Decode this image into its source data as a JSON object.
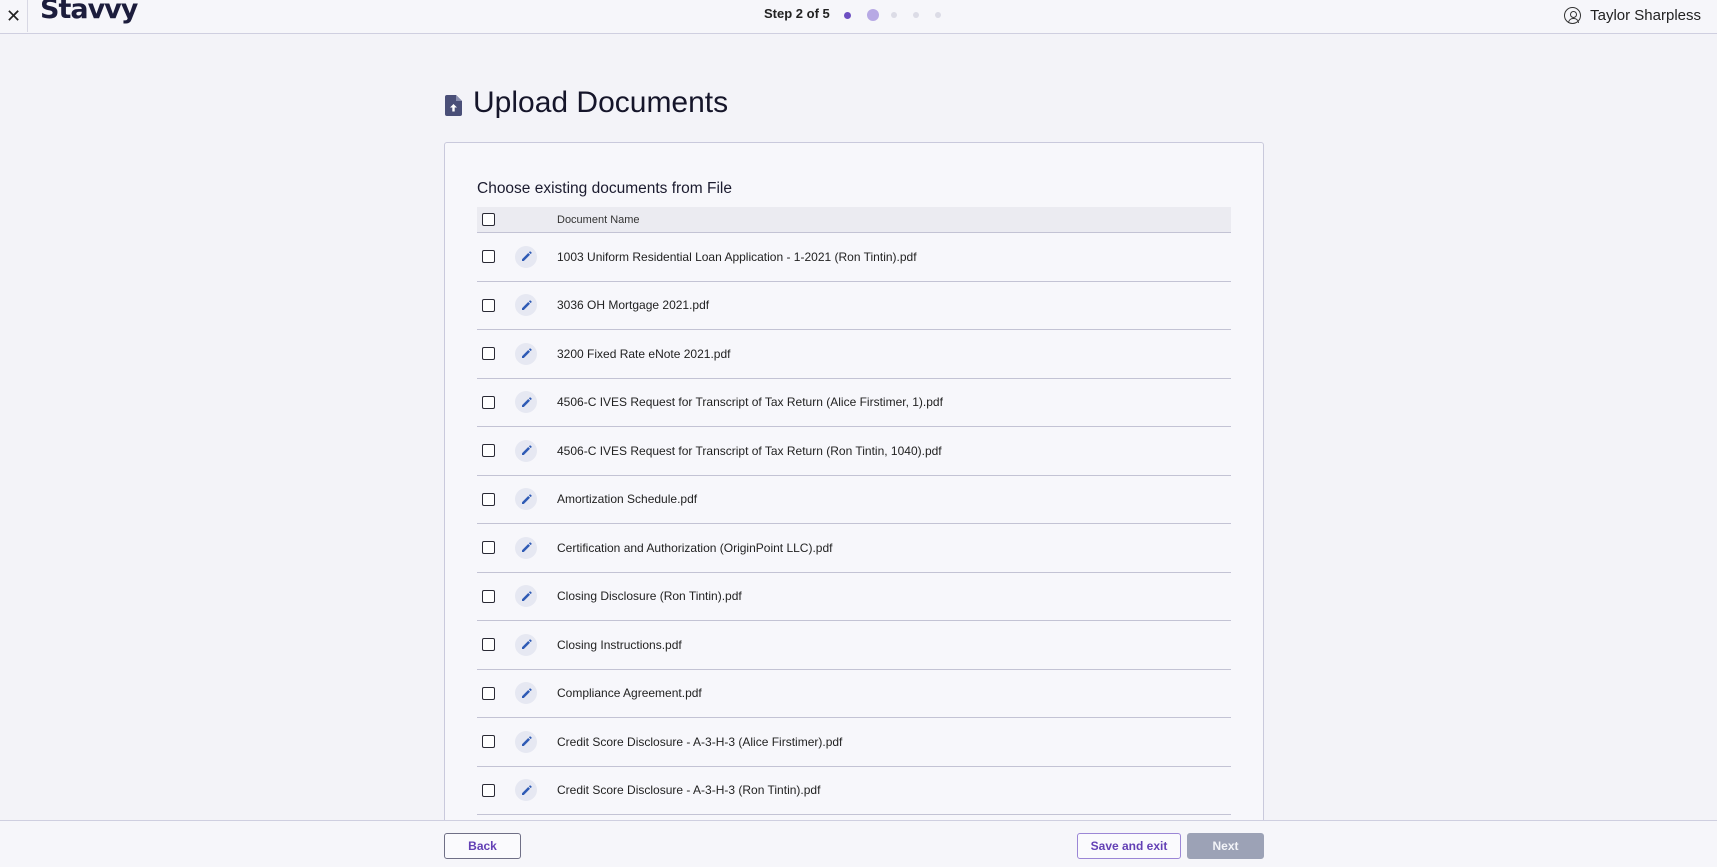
{
  "header": {
    "close_glyph": "✕",
    "logo": "Stavvy",
    "step_label": "Step 2 of 5",
    "steps_total": 5,
    "current_step": 2,
    "user_name": "Taylor Sharpless"
  },
  "page": {
    "title": "Upload Documents",
    "title_icon": "file-upload-icon"
  },
  "card": {
    "subtitle": "Choose existing documents from File",
    "column_header": "Document Name",
    "documents": [
      "1003 Uniform Residential Loan Application - 1-2021 (Ron Tintin).pdf",
      "3036 OH Mortgage 2021.pdf",
      "3200 Fixed Rate eNote 2021.pdf",
      "4506-C IVES Request for Transcript of Tax Return (Alice Firstimer, 1).pdf",
      "4506-C IVES Request for Transcript of Tax Return (Ron Tintin, 1040).pdf",
      "Amortization Schedule.pdf",
      "Certification and Authorization (OriginPoint LLC).pdf",
      "Closing Disclosure (Ron Tintin).pdf",
      "Closing Instructions.pdf",
      "Compliance Agreement.pdf",
      "Credit Score Disclosure - A-3-H-3 (Alice Firstimer).pdf",
      "Credit Score Disclosure - A-3-H-3 (Ron Tintin).pdf"
    ]
  },
  "footer": {
    "back_label": "Back",
    "save_label": "Save and exit",
    "next_label": "Next"
  },
  "colors": {
    "accent": "#6340b5",
    "step_done": "#6d4fc2",
    "step_current": "#b7a9e4",
    "edit_icon": "#2f5bb5",
    "next_disabled": "#9ca2b6"
  }
}
